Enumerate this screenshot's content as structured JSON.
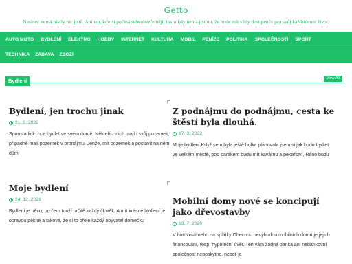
{
  "site": {
    "title": "Getto",
    "description": "Nasinec nemá nikdy nic jisté. Ani ten, kdo si počíná sebeobezřetněji, tak nikdy nemá jistotu, že bude mít vždy dost peněz pro svůj každodenní život."
  },
  "nav": {
    "row1": [
      "AUTO MOTO",
      "BYDLENÍ",
      "ELEKTRO",
      "HOBBY",
      "INTERNET",
      "KULTURA",
      "MOBIL",
      "PENÍZE",
      "POLITIKA",
      "SPOLEČNOSTI",
      "SPORT"
    ],
    "row2": [
      "TECHNIKA",
      "ZÁBAVA",
      "ZBOŽÍ"
    ]
  },
  "section": {
    "label": "Bydlení",
    "view_all": "View All"
  },
  "posts": [
    {
      "title": "Bydlení, jen trochu jinak",
      "date": "21. 3. 2022",
      "excerpt": "Spousta lidí chce bydlet ve svém domě. Někteří z nich mají i svůj pozemek, případně mají pozemek v pronájmu. Jenže, mít pozemek a postavit na něm dům"
    },
    {
      "title": "Z podnájmu do podnájmu, cesta ke štěstí byla dlouhá.",
      "date": "17. 3. 2022",
      "excerpt": "Moje bydlení Když sem byla ještě holka plánovala jsem si jak budu bydlet ve velkém městě, pod barákem budu mít kavárnu a pekařství, Ráno budu"
    },
    {
      "title": "Moje bydlení",
      "date": "24. 12. 2021",
      "excerpt": "Bydlení je něco, po čem touží určitě každý člověk. A mít krásné bydlení je opravdu pěkné a takové, že si to přeje každý obyvatel domečku"
    },
    {
      "title": "Mobilní domy nové se koncipují jako dřevostavby",
      "date": "13. 7. 2020",
      "excerpt": "V hotovosti nebo na splátky Obecnou nevýhodou mobilních domů je jejich financování, resp. hypoteční úvěr. Ten vám žádná banka ani nebankovní společnost neposkytne, neboť je"
    }
  ],
  "colors": {
    "accent": "#1ec06a"
  }
}
